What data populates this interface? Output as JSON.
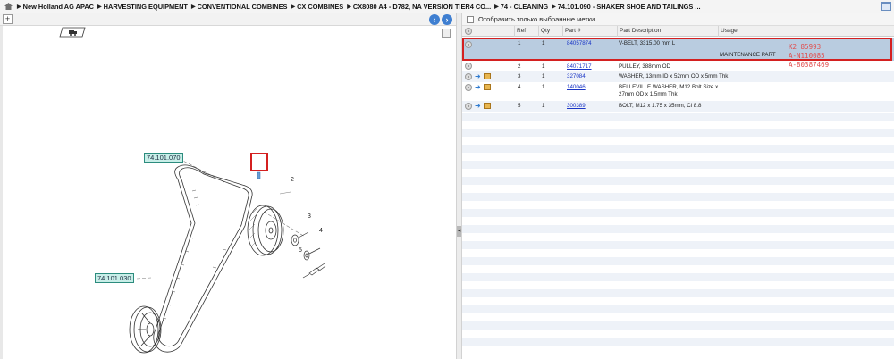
{
  "breadcrumb": [
    "New Holland AG APAC",
    "HARVESTING EQUIPMENT",
    "CONVENTIONAL COMBINES",
    "CX COMBINES",
    "CX8080 A4 - D782, NA VERSION TIER4 CO...",
    "74 - CLEANING",
    "74.101.090 - SHAKER SHOE AND TAILINGS ..."
  ],
  "diagram": {
    "callouts": [
      "74.101.070",
      "74.101.030"
    ],
    "item_numbers": [
      "2",
      "3",
      "4",
      "5"
    ]
  },
  "filter": {
    "label": "Отобразить только выбранные метки",
    "checked": false
  },
  "grid": {
    "columns": [
      "Ref",
      "Qty",
      "Part #",
      "Part Description",
      "Usage"
    ],
    "rows": [
      {
        "ref": "1",
        "qty": "1",
        "part": "84057874",
        "desc": "V-BELT, 3315.00 mm L",
        "usage": "MAINTENANCE PART",
        "selected": true,
        "icons": false
      },
      {
        "ref": "2",
        "qty": "1",
        "part": "84071717",
        "desc": "PULLEY, 388mm OD",
        "usage": "",
        "selected": false,
        "icons": false
      },
      {
        "ref": "3",
        "qty": "1",
        "part": "327084",
        "desc": "WASHER, 13mm ID x 52mm OD x 5mm Thk",
        "usage": "",
        "selected": false,
        "icons": true
      },
      {
        "ref": "4",
        "qty": "1",
        "part": "140046",
        "desc": "BELLEVILLE WASHER, M12 Bolt Size x",
        "desc2": "27mm OD x 1.5mm Thk",
        "usage": "",
        "selected": false,
        "icons": true
      },
      {
        "ref": "5",
        "qty": "1",
        "part": "300389",
        "desc": "BOLT, M12 x 1.75 x 35mm, Cl 8.8",
        "usage": "",
        "selected": false,
        "icons": true
      }
    ]
  },
  "handwritten_notes": [
    "K2 85993",
    "A-N110085",
    "A-80387469"
  ],
  "colors": {
    "highlight": "#d42020",
    "selected_row": "#b9cce0",
    "link": "#1a35c6",
    "note": "#e05050"
  }
}
